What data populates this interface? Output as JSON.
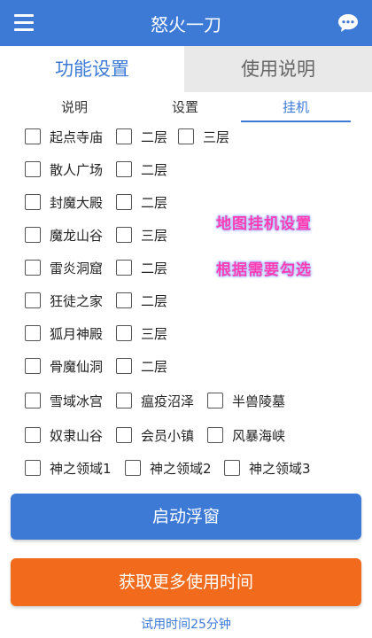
{
  "app": {
    "title": "怒火一刀",
    "accent": "#3d7ad6",
    "orange": "#f26b1d",
    "menu_icon": "hamburger-menu-icon",
    "chat_icon": "chat-bubble-icon"
  },
  "top_tabs": [
    {
      "label": "功能设置",
      "active": true
    },
    {
      "label": "使用说明",
      "active": false
    }
  ],
  "sub_tabs": [
    {
      "label": "说明"
    },
    {
      "label": "设置"
    },
    {
      "label": "挂机",
      "active": true
    }
  ],
  "rows": [
    [
      "起点寺庙",
      "二层",
      "三层"
    ],
    [
      "散人广场",
      "二层"
    ],
    [
      "封魔大殿",
      "二层"
    ],
    [
      "魔龙山谷",
      "三层"
    ],
    [
      "雷炎洞窟",
      "二层"
    ],
    [
      "狂徒之家",
      "二层"
    ],
    [
      "狐月神殿",
      "三层"
    ],
    [
      "骨魔仙洞",
      "二层"
    ],
    [
      "雪域冰宫",
      "瘟疫沼泽",
      "半兽陵墓"
    ],
    [
      "奴隶山谷",
      "会员小镇",
      "风暴海峡"
    ],
    [
      "神之领域1",
      "神之领域2",
      "神之领域3"
    ]
  ],
  "overlay": {
    "line1": "地图挂机设置",
    "line2": "根据需要勾选"
  },
  "buttons": {
    "start_float": "启动浮窗",
    "get_more_time": "获取更多使用时间"
  },
  "trial_text": "试用时间25分钟"
}
